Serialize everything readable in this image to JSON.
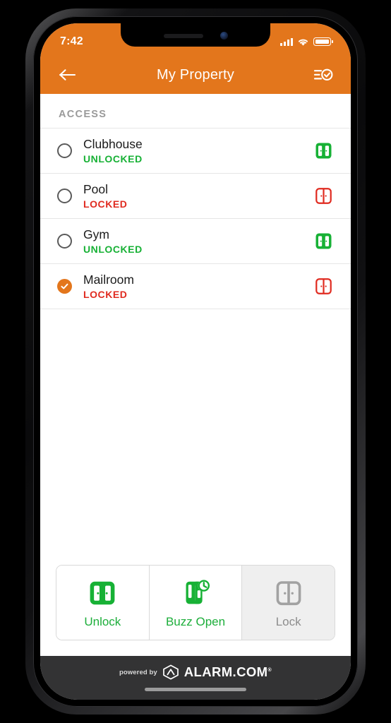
{
  "status_bar": {
    "time": "7:42",
    "signal_icon": "cellular-signal-icon",
    "wifi_icon": "wifi-icon",
    "battery_icon": "battery-full-icon"
  },
  "header": {
    "title": "My Property",
    "back_icon": "back-arrow-icon",
    "action_icon": "checklist-check-icon",
    "background_color": "#E3761C",
    "text_color": "#FFFFFF"
  },
  "section": {
    "label": "ACCESS"
  },
  "colors": {
    "accent_orange": "#E3761C",
    "unlocked_green": "#17B135",
    "locked_red": "#E02B20",
    "disabled_gray": "#8D8D8D"
  },
  "access_list": [
    {
      "name": "Clubhouse",
      "status": "UNLOCKED",
      "status_color": "#17B135",
      "selected": false,
      "door_icon": "door-open-icon"
    },
    {
      "name": "Pool",
      "status": "LOCKED",
      "status_color": "#E02B20",
      "selected": false,
      "door_icon": "door-closed-icon"
    },
    {
      "name": "Gym",
      "status": "UNLOCKED",
      "status_color": "#17B135",
      "selected": false,
      "door_icon": "door-open-icon"
    },
    {
      "name": "Mailroom",
      "status": "LOCKED",
      "status_color": "#E02B20",
      "selected": true,
      "door_icon": "door-closed-icon"
    }
  ],
  "actions": [
    {
      "label": "Unlock",
      "icon": "door-unlock-icon",
      "enabled": true
    },
    {
      "label": "Buzz Open",
      "icon": "door-buzz-clock-icon",
      "enabled": true
    },
    {
      "label": "Lock",
      "icon": "door-lock-icon",
      "enabled": false
    }
  ],
  "footer": {
    "powered_by": "powered by",
    "brand": "ALARM.COM",
    "trademark": "®",
    "logo_icon": "alarm-dot-com-hex-logo"
  }
}
